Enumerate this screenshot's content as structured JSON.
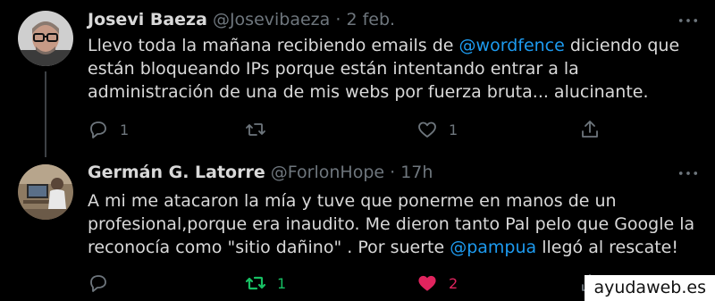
{
  "tweets": [
    {
      "author": {
        "name": "Josevi Baeza",
        "handle": "@Josevibaeza"
      },
      "separator": "·",
      "time": "2 feb.",
      "text": {
        "p1": "Llevo toda la mañana recibiendo emails de ",
        "mention1": "@wordfence",
        "p2": " diciendo que están bloqueando IPs porque están intentando entrar a la administración de una de mis webs por fuerza bruta... alucinante."
      },
      "actions": {
        "replies": "1",
        "retweets": "",
        "likes": "1"
      }
    },
    {
      "author": {
        "name": "Germán G. Latorre",
        "handle": "@ForlonHope"
      },
      "separator": "·",
      "time": "17h",
      "text": {
        "p1": "A mi me atacaron la mía y tuve que ponerme en manos de un profesional,porque era inaudito. Me dieron tanto Pal pelo que Google la reconocía como \"sitio dañino\" . Por suerte ",
        "mention1": "@pampua",
        "p2": " llegó al rescate!"
      },
      "actions": {
        "replies": "",
        "retweets": "1",
        "likes": "2"
      }
    }
  ],
  "colors": {
    "background": "#000000",
    "text": "#d9d9d9",
    "muted": "#6e767d",
    "link": "#1d9bf0",
    "retweet_active": "#17bf63",
    "like_active": "#e0245e"
  },
  "icons": [
    "more-icon",
    "reply-icon",
    "retweet-icon",
    "like-icon",
    "share-icon"
  ],
  "watermark": "ayudaweb.es"
}
